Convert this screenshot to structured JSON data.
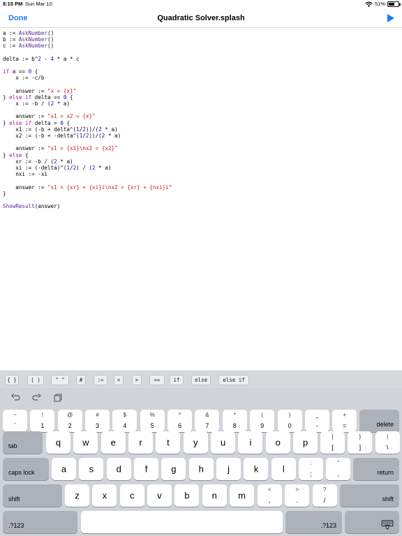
{
  "status": {
    "time": "8:15 PM",
    "date": "Sun Mar 10",
    "battery": "51%",
    "battery_level": 0.51
  },
  "nav": {
    "done_label": "Done",
    "title": "Quadratic Solver.splash",
    "play_icon": "play-icon"
  },
  "code_lines": [
    [
      [
        "a := ",
        "op"
      ],
      [
        "AskNumber",
        "fn"
      ],
      [
        "()",
        "op"
      ]
    ],
    [
      [
        "b := ",
        "op"
      ],
      [
        "AskNumber",
        "fn"
      ],
      [
        "()",
        "op"
      ]
    ],
    [
      [
        "c := ",
        "op"
      ],
      [
        "AskNumber",
        "fn"
      ],
      [
        "()",
        "op"
      ]
    ],
    [],
    [
      [
        "delta := b^",
        "op"
      ],
      [
        "2",
        "num"
      ],
      [
        " - ",
        "op"
      ],
      [
        "4",
        "num"
      ],
      [
        " * a * c",
        "op"
      ]
    ],
    [],
    [
      [
        "if",
        "kw"
      ],
      [
        " a == ",
        "op"
      ],
      [
        "0",
        "num"
      ],
      [
        " {",
        "op"
      ]
    ],
    [
      [
        "    x := -c/b",
        "op"
      ]
    ],
    [],
    [
      [
        "    answer := ",
        "op"
      ],
      [
        "\"x = {x}\"",
        "str"
      ]
    ],
    [
      [
        "} ",
        "op"
      ],
      [
        "else if",
        "kw"
      ],
      [
        " delta == ",
        "op"
      ],
      [
        "0",
        "num"
      ],
      [
        " {",
        "op"
      ]
    ],
    [
      [
        "    x := -b / (",
        "op"
      ],
      [
        "2",
        "num"
      ],
      [
        " * a)",
        "op"
      ]
    ],
    [],
    [
      [
        "    answer := ",
        "op"
      ],
      [
        "\"x1 = x2 = {x}\"",
        "str"
      ]
    ],
    [
      [
        "} ",
        "op"
      ],
      [
        "else if",
        "kw"
      ],
      [
        " delta > ",
        "op"
      ],
      [
        "0",
        "num"
      ],
      [
        " {",
        "op"
      ]
    ],
    [
      [
        "    x1 := (-b + delta^(",
        "op"
      ],
      [
        "1",
        "num"
      ],
      [
        "/",
        "op"
      ],
      [
        "2",
        "num"
      ],
      [
        "))/(",
        "op"
      ],
      [
        "2",
        "num"
      ],
      [
        " * a)",
        "op"
      ]
    ],
    [
      [
        "    x2 := (-b + -delta^(",
        "op"
      ],
      [
        "1",
        "num"
      ],
      [
        "/",
        "op"
      ],
      [
        "2",
        "num"
      ],
      [
        "))/(",
        "op"
      ],
      [
        "2",
        "num"
      ],
      [
        " * a)",
        "op"
      ]
    ],
    [],
    [
      [
        "    answer := ",
        "op"
      ],
      [
        "\"x1 = {x1}\\nx2 = {x2}\"",
        "str"
      ]
    ],
    [
      [
        "} ",
        "op"
      ],
      [
        "else",
        "kw"
      ],
      [
        " {",
        "op"
      ]
    ],
    [
      [
        "    xr := -b / (",
        "op"
      ],
      [
        "2",
        "num"
      ],
      [
        " * a)",
        "op"
      ]
    ],
    [
      [
        "    xi := (-delta)^(",
        "op"
      ],
      [
        "1",
        "num"
      ],
      [
        "/",
        "op"
      ],
      [
        "2",
        "num"
      ],
      [
        ") / (",
        "op"
      ],
      [
        "2",
        "num"
      ],
      [
        " * a)",
        "op"
      ]
    ],
    [
      [
        "    nxi := -xi",
        "op"
      ]
    ],
    [],
    [
      [
        "    answer := ",
        "op"
      ],
      [
        "\"x1 = {xr} + {xi}i\\nx2 = {xr} + {nxi}i\"",
        "str"
      ]
    ],
    [
      [
        "}",
        "op"
      ]
    ],
    [],
    [
      [
        "ShowResult",
        "fn"
      ],
      [
        "(answer)",
        "op"
      ]
    ]
  ],
  "shortcuts": [
    "{ }",
    "( )",
    "\" \"",
    "#",
    ":=",
    "<",
    ">",
    "==",
    "if",
    "else",
    "else if"
  ],
  "toolbar": {
    "undo_icon": "undo-icon",
    "redo_icon": "redo-icon",
    "paste_icon": "paste-icon"
  },
  "keyboard": {
    "row1": [
      {
        "top": "~",
        "bot": "`"
      },
      {
        "top": "!",
        "bot": "1"
      },
      {
        "top": "@",
        "bot": "2"
      },
      {
        "top": "#",
        "bot": "3"
      },
      {
        "top": "$",
        "bot": "4"
      },
      {
        "top": "%",
        "bot": "5"
      },
      {
        "top": "^",
        "bot": "6"
      },
      {
        "top": "&",
        "bot": "7"
      },
      {
        "top": "*",
        "bot": "8"
      },
      {
        "top": "(",
        "bot": "9"
      },
      {
        "top": ")",
        "bot": "0"
      },
      {
        "top": "_",
        "bot": "-"
      },
      {
        "top": "+",
        "bot": "="
      }
    ],
    "delete": "delete",
    "tab": "tab",
    "row2": [
      "q",
      "w",
      "e",
      "r",
      "t",
      "y",
      "u",
      "i",
      "o",
      "p"
    ],
    "row2_extra": [
      {
        "top": "{",
        "bot": "["
      },
      {
        "top": "}",
        "bot": "]"
      },
      {
        "top": "|",
        "bot": "\\"
      }
    ],
    "caps": "caps lock",
    "row3": [
      "a",
      "s",
      "d",
      "f",
      "g",
      "h",
      "j",
      "k",
      "l"
    ],
    "row3_extra": [
      {
        "top": ":",
        "bot": ";"
      },
      {
        "top": "\"",
        "bot": ","
      }
    ],
    "return": "return",
    "shift": "shift",
    "row4": [
      "z",
      "x",
      "c",
      "v",
      "b",
      "n",
      "m"
    ],
    "row4_extra": [
      {
        "top": "<",
        "bot": ","
      },
      {
        "top": ">",
        "bot": "."
      },
      {
        "top": "?",
        "bot": "/"
      }
    ],
    "shift_right": "shift",
    "num_left": ".?123",
    "num_right": ".?123",
    "hide_icon": "keyboard-hide-icon"
  }
}
